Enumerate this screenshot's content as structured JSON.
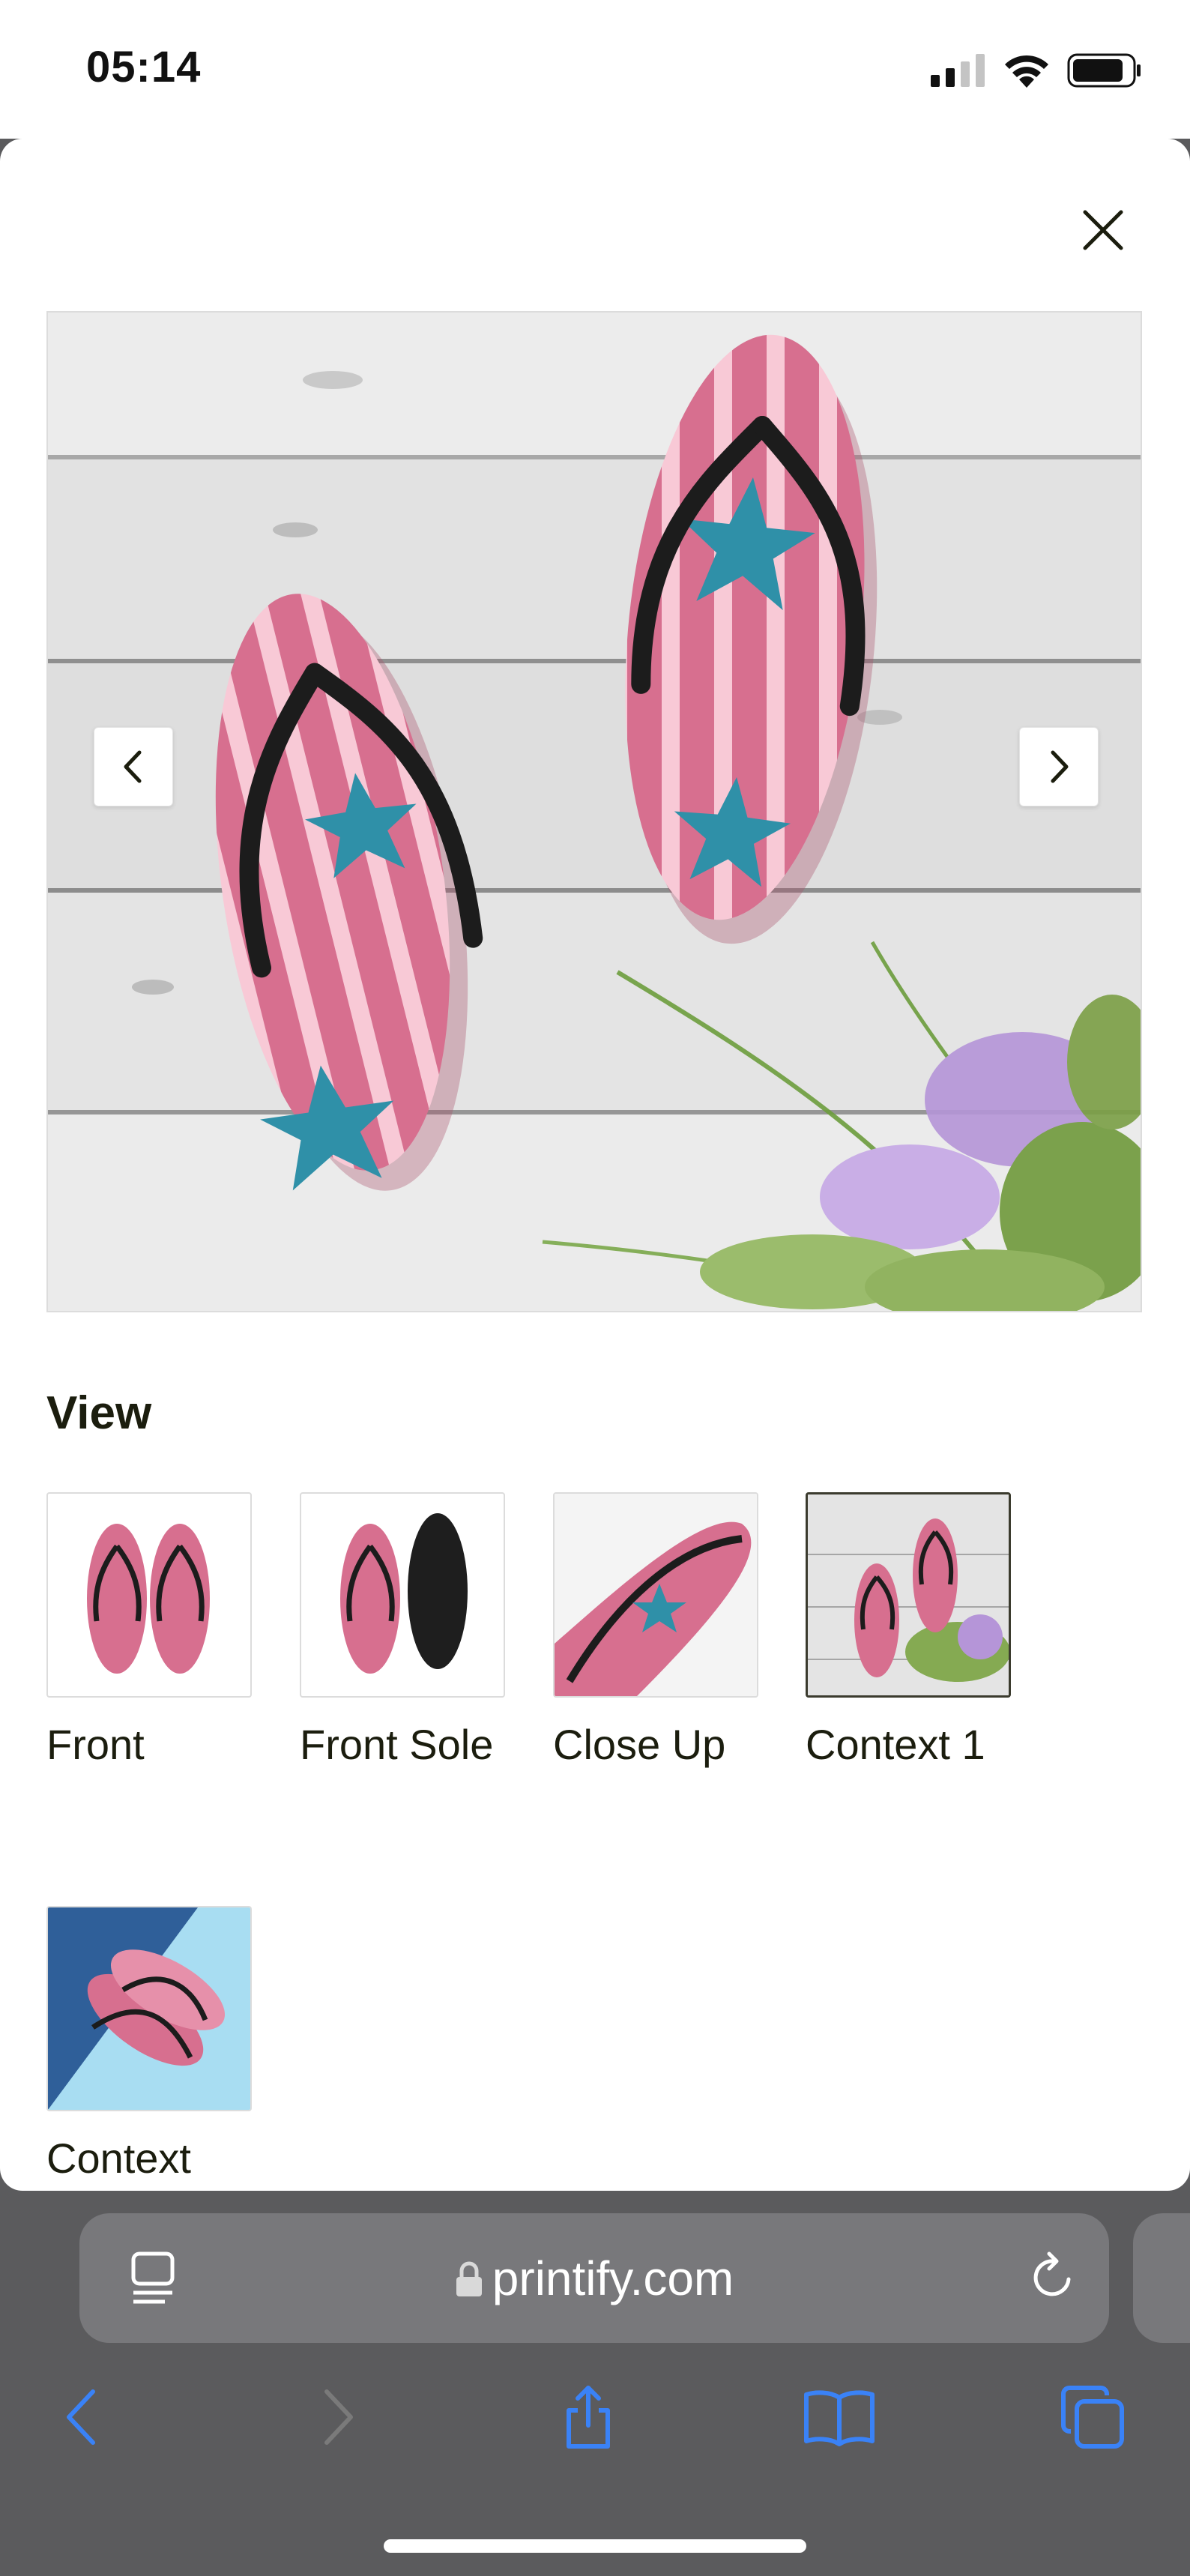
{
  "status_bar": {
    "time": "05:14",
    "icons": [
      "cellular-signal-icon",
      "wifi-icon",
      "battery-icon"
    ]
  },
  "modal": {
    "close_icon": "close-icon",
    "gallery": {
      "prev_icon": "chevron-left-icon",
      "next_icon": "chevron-right-icon"
    },
    "view_heading": "View",
    "thumbnails": [
      {
        "label": "Front",
        "selected": false
      },
      {
        "label": "Front Sole",
        "selected": false
      },
      {
        "label": "Close Up",
        "selected": false
      },
      {
        "label": "Context 1",
        "selected": true
      },
      {
        "label": "Context",
        "selected": false
      }
    ]
  },
  "browser": {
    "url": "printify.com",
    "toolbar": [
      "back-icon",
      "forward-icon",
      "share-icon",
      "bookmarks-icon",
      "tabs-icon"
    ]
  },
  "colors": {
    "sandal_pink": "#d76f8f",
    "stripe_light": "#f8c9d6",
    "star_teal": "#2f90a8",
    "strap_black": "#1c1c1c",
    "safari_blue": "#3a82f7",
    "toolbar_gray": "#5b5b5d"
  }
}
